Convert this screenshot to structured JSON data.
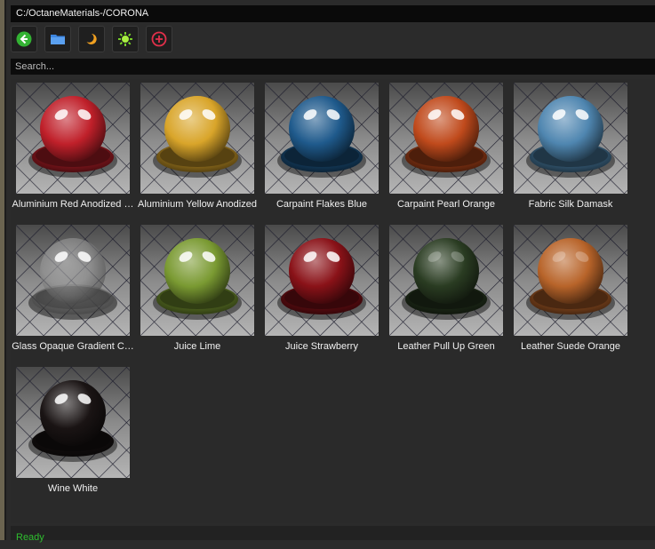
{
  "path": "C:/OctaneMaterials-/CORONA",
  "toolbar": [
    {
      "name": "back-button",
      "icon": "back-arrow-icon"
    },
    {
      "name": "open-folder-button",
      "icon": "folder-icon"
    },
    {
      "name": "night-mode-button",
      "icon": "moon-icon"
    },
    {
      "name": "light-mode-button",
      "icon": "sun-icon"
    },
    {
      "name": "add-button",
      "icon": "plus-circle-icon"
    }
  ],
  "search": {
    "placeholder": "Search..."
  },
  "materials": [
    {
      "label": "Aluminium Red Anodized …",
      "color": "#c0202a",
      "style": "metal"
    },
    {
      "label": "Aluminium Yellow Anodized",
      "color": "#d9a52a",
      "style": "metal"
    },
    {
      "label": "Carpaint Flakes Blue",
      "color": "#1f5a8c",
      "style": "glossy"
    },
    {
      "label": "Carpaint Pearl Orange",
      "color": "#c04a1c",
      "style": "glossy"
    },
    {
      "label": "Fabric Silk Damask",
      "color": "#4f86b0",
      "style": "glossy"
    },
    {
      "label": "Glass Opaque Gradient C…",
      "color": "#9a9a9a",
      "style": "glass"
    },
    {
      "label": "Juice Lime",
      "color": "#7a9a32",
      "style": "glossy"
    },
    {
      "label": "Juice Strawberry",
      "color": "#8a1218",
      "style": "glossy"
    },
    {
      "label": "Leather Pull Up Green",
      "color": "#2a3c22",
      "style": "matte"
    },
    {
      "label": "Leather Suede Orange",
      "color": "#b8642a",
      "style": "matte"
    },
    {
      "label": "Wine White",
      "color": "#1a1414",
      "style": "glossy"
    }
  ],
  "status": "Ready"
}
